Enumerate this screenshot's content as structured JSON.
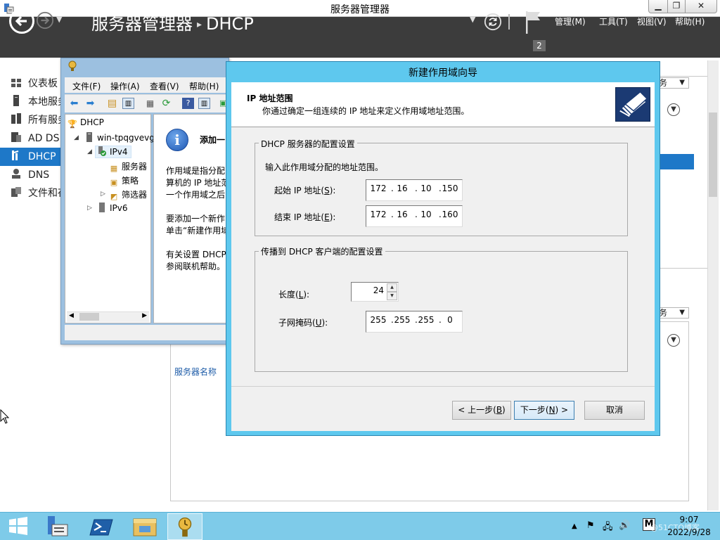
{
  "server_manager": {
    "title": "服务器管理器",
    "window_buttons": {
      "minimize": "▁",
      "maximize": "❐",
      "close": "✕"
    },
    "breadcrumb": {
      "root": "服务器管理器",
      "separator": "▸",
      "current": "DHCP"
    },
    "notifications_count": "2",
    "menus": {
      "manage": "管理(M)",
      "tools": "工具(T)",
      "view": "视图(V)",
      "help": "帮助(H)"
    },
    "left_nav": [
      {
        "label": "仪表板",
        "icon": "dashboard-icon"
      },
      {
        "label": "本地服务器",
        "icon": "local-server-icon"
      },
      {
        "label": "所有服务器",
        "icon": "all-servers-icon"
      },
      {
        "label": "AD DS",
        "icon": "ad-ds-icon"
      },
      {
        "label": "DHCP",
        "icon": "dhcp-icon",
        "selected": true
      },
      {
        "label": "DNS",
        "icon": "dns-icon"
      },
      {
        "label": "文件和存储服务",
        "icon": "file-storage-icon"
      }
    ],
    "tasks_label": "务",
    "servers_column": "服务器名称"
  },
  "dhcp_console": {
    "menus": [
      "文件(F)",
      "操作(A)",
      "查看(V)",
      "帮助(H)"
    ],
    "tree": {
      "root": "DHCP",
      "server": "win-tpqgvevg",
      "ipv4": "IPv4",
      "children": [
        "服务器",
        "策略",
        "筛选器"
      ],
      "ipv6": "IPv6"
    },
    "content": {
      "heading": "添加一",
      "lines": [
        "作用域是指分配",
        "算机的 IP 地址范",
        "一个作用域之后",
        "",
        "要添加一个新作",
        "单击“新建作用域",
        "",
        "有关设置 DHCP",
        "参阅联机帮助。"
      ]
    }
  },
  "wizard": {
    "title": "新建作用域向导",
    "banner_title": "IP 地址范围",
    "banner_subtitle": "你通过确定一组连续的 IP 地址来定义作用域地址范围。",
    "group1_label": "DHCP 服务器的配置设置",
    "instruction": "输入此作用域分配的地址范围。",
    "start_ip_label": "起始 IP 地址(",
    "start_ip_key": "S",
    "end_ip_label": "结束 IP 地址(",
    "end_ip_key": "E",
    "start_ip": [
      "172",
      "16",
      "10",
      "150"
    ],
    "end_ip": [
      "172",
      "16",
      "10",
      "160"
    ],
    "group2_label": "传播到 DHCP 客户端的配置设置",
    "length_label": "长度(",
    "length_key": "L",
    "length": "24",
    "mask_label": "子网掩码(",
    "mask_key": "U",
    "subnet_mask": [
      "255",
      "255",
      "255",
      "0"
    ],
    "buttons": {
      "back_prefix": "< 上一步(",
      "back_key": "B",
      "next_prefix": "下一步(",
      "next_key": "N",
      "next_suffix": ") >",
      "cancel": "取消"
    }
  },
  "taskbar": {
    "apps": [
      "server-manager",
      "powershell",
      "file-explorer",
      "dhcp"
    ],
    "ime": "M",
    "time": "9:07",
    "date": "2022/9/28",
    "watermark": "@51CTO博客"
  },
  "colors": {
    "header_bg": "#3c3c3c",
    "selection": "#1e78c8",
    "wizard_frame": "#5ec8ee",
    "taskbar": "#7ecbe9"
  }
}
